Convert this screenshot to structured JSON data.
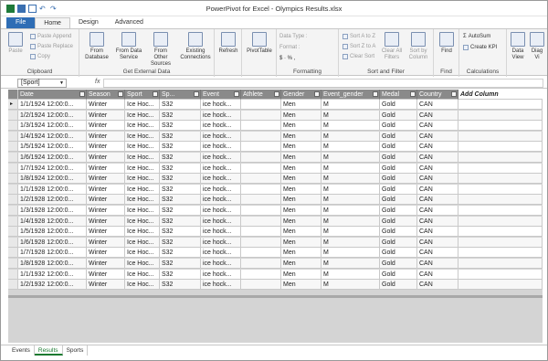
{
  "window": {
    "title": "PowerPivot for Excel - Olympics Results.xlsx"
  },
  "tabs": [
    "File",
    "Home",
    "Design",
    "Advanced"
  ],
  "ribbon": {
    "clipboard": {
      "paste": "Paste",
      "paste_append": "Paste Append",
      "paste_replace": "Paste Replace",
      "copy": "Copy",
      "label": "Clipboard"
    },
    "external": {
      "from_database": "From Database",
      "from_data_service": "From Data Service",
      "from_other_sources": "From Other Sources",
      "existing_connections": "Existing Connections",
      "label": "Get External Data"
    },
    "refresh": "Refresh",
    "pivottable": "PivotTable",
    "formatting": {
      "data_type": "Data Type :",
      "format": "Format :",
      "symbols": "$ · % ,",
      "label": "Formatting"
    },
    "sort_filter": {
      "sort_az": "Sort A to Z",
      "sort_za": "Sort Z to A",
      "clear_sort": "Clear Sort",
      "clear_all_filters": "Clear All Filters",
      "sort_by_column": "Sort by Column",
      "label": "Sort and Filter"
    },
    "find": {
      "find": "Find",
      "label": "Find"
    },
    "calculations": {
      "autosum": "AutoSum",
      "create_kpi": "Create KPI",
      "label": "Calculations"
    },
    "view": {
      "data_view": "Data View",
      "diagram_view": "Diag Vi"
    }
  },
  "formula_bar": {
    "name_box": "[Sport]",
    "fx": "fx",
    "formula": ""
  },
  "table": {
    "columns": [
      "Date",
      "Season",
      "Sport",
      "Sp...",
      "Event",
      "Athlete",
      "Gender",
      "Event_gender",
      "Medal",
      "Country"
    ],
    "add_column": "Add Column",
    "rows": [
      [
        "1/1/1924 12:00:0...",
        "Winter",
        "Ice Hoc...",
        "S32",
        "ice hock...",
        "",
        "Men",
        "M",
        "Gold",
        "CAN"
      ],
      [
        "1/2/1924 12:00:0...",
        "Winter",
        "Ice Hoc...",
        "S32",
        "ice hock...",
        "",
        "Men",
        "M",
        "Gold",
        "CAN"
      ],
      [
        "1/3/1924 12:00:0...",
        "Winter",
        "Ice Hoc...",
        "S32",
        "ice hock...",
        "",
        "Men",
        "M",
        "Gold",
        "CAN"
      ],
      [
        "1/4/1924 12:00:0...",
        "Winter",
        "Ice Hoc...",
        "S32",
        "ice hock...",
        "",
        "Men",
        "M",
        "Gold",
        "CAN"
      ],
      [
        "1/5/1924 12:00:0...",
        "Winter",
        "Ice Hoc...",
        "S32",
        "ice hock...",
        "",
        "Men",
        "M",
        "Gold",
        "CAN"
      ],
      [
        "1/6/1924 12:00:0...",
        "Winter",
        "Ice Hoc...",
        "S32",
        "ice hock...",
        "",
        "Men",
        "M",
        "Gold",
        "CAN"
      ],
      [
        "1/7/1924 12:00:0...",
        "Winter",
        "Ice Hoc...",
        "S32",
        "ice hock...",
        "",
        "Men",
        "M",
        "Gold",
        "CAN"
      ],
      [
        "1/8/1924 12:00:0...",
        "Winter",
        "Ice Hoc...",
        "S32",
        "ice hock...",
        "",
        "Men",
        "M",
        "Gold",
        "CAN"
      ],
      [
        "1/1/1928 12:00:0...",
        "Winter",
        "Ice Hoc...",
        "S32",
        "ice hock...",
        "",
        "Men",
        "M",
        "Gold",
        "CAN"
      ],
      [
        "1/2/1928 12:00:0...",
        "Winter",
        "Ice Hoc...",
        "S32",
        "ice hock...",
        "",
        "Men",
        "M",
        "Gold",
        "CAN"
      ],
      [
        "1/3/1928 12:00:0...",
        "Winter",
        "Ice Hoc...",
        "S32",
        "ice hock...",
        "",
        "Men",
        "M",
        "Gold",
        "CAN"
      ],
      [
        "1/4/1928 12:00:0...",
        "Winter",
        "Ice Hoc...",
        "S32",
        "ice hock...",
        "",
        "Men",
        "M",
        "Gold",
        "CAN"
      ],
      [
        "1/5/1928 12:00:0...",
        "Winter",
        "Ice Hoc...",
        "S32",
        "ice hock...",
        "",
        "Men",
        "M",
        "Gold",
        "CAN"
      ],
      [
        "1/6/1928 12:00:0...",
        "Winter",
        "Ice Hoc...",
        "S32",
        "ice hock...",
        "",
        "Men",
        "M",
        "Gold",
        "CAN"
      ],
      [
        "1/7/1928 12:00:0...",
        "Winter",
        "Ice Hoc...",
        "S32",
        "ice hock...",
        "",
        "Men",
        "M",
        "Gold",
        "CAN"
      ],
      [
        "1/8/1928 12:00:0...",
        "Winter",
        "Ice Hoc...",
        "S32",
        "ice hock...",
        "",
        "Men",
        "M",
        "Gold",
        "CAN"
      ],
      [
        "1/1/1932 12:00:0...",
        "Winter",
        "Ice Hoc...",
        "S32",
        "ice hock...",
        "",
        "Men",
        "M",
        "Gold",
        "CAN"
      ],
      [
        "1/2/1932 12:00:0...",
        "Winter",
        "Ice Hoc...",
        "S32",
        "ice hock...",
        "",
        "Men",
        "M",
        "Gold",
        "CAN"
      ]
    ]
  },
  "sheet_tabs": [
    "Events",
    "Results",
    "Sports"
  ],
  "active_sheet": "Results",
  "colors": {
    "file_tab": "#2e6db5",
    "header": "#8a8a8a",
    "active_sheet": "#1a7a30"
  }
}
